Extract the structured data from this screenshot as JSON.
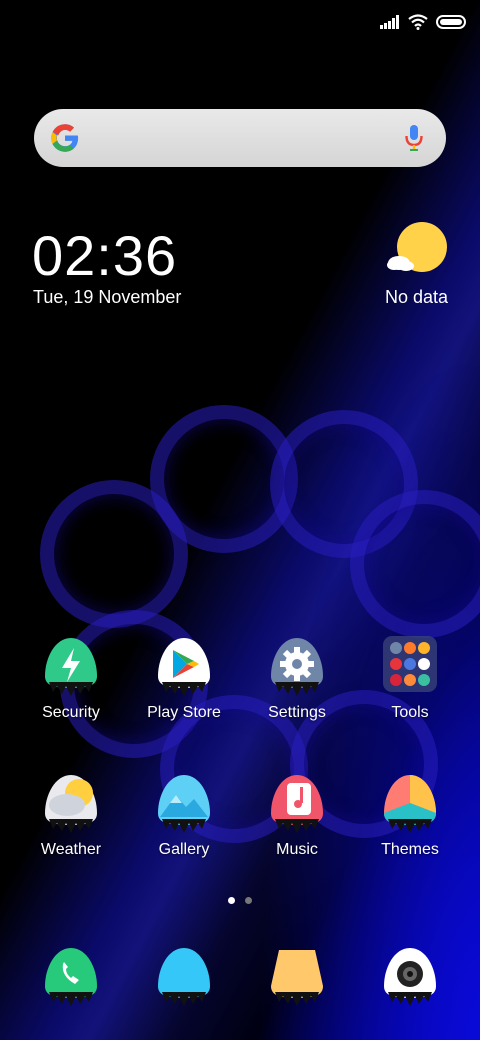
{
  "status_bar": {
    "icons": [
      "signal-icon",
      "wifi-icon",
      "battery-icon"
    ]
  },
  "search": {
    "icons": [
      "google-logo",
      "mic-icon"
    ]
  },
  "clock": {
    "time": "02:36",
    "date": "Tue, 19 November"
  },
  "weather_widget": {
    "status": "No data",
    "icon": "partly-cloudy-icon"
  },
  "apps": [
    {
      "label": "Security",
      "icon": "lightning-icon",
      "color": "#2fca8a"
    },
    {
      "label": "Play Store",
      "icon": "play-store-icon",
      "color": "#ffffff"
    },
    {
      "label": "Settings",
      "icon": "gear-icon",
      "color": "#6f86a8"
    },
    {
      "label": "Tools",
      "icon": "folder-icon",
      "color": "#2b3560"
    },
    {
      "label": "Weather",
      "icon": "weather-icon",
      "color": "#e9e9ee"
    },
    {
      "label": "Gallery",
      "icon": "mountain-icon",
      "color": "#5ed0f5"
    },
    {
      "label": "Music",
      "icon": "music-note-icon",
      "color": "#f1556a"
    },
    {
      "label": "Themes",
      "icon": "themes-icon",
      "color": "#ff7c72"
    }
  ],
  "dock": [
    {
      "icon": "phone-icon",
      "color": "#27c97a"
    },
    {
      "icon": "messages-icon",
      "color": "#35c7f7"
    },
    {
      "icon": "notes-icon",
      "color": "#ffc96b"
    },
    {
      "icon": "camera-icon",
      "color": "#ffffff"
    }
  ],
  "page_indicator": {
    "count": 2,
    "active": 1
  }
}
